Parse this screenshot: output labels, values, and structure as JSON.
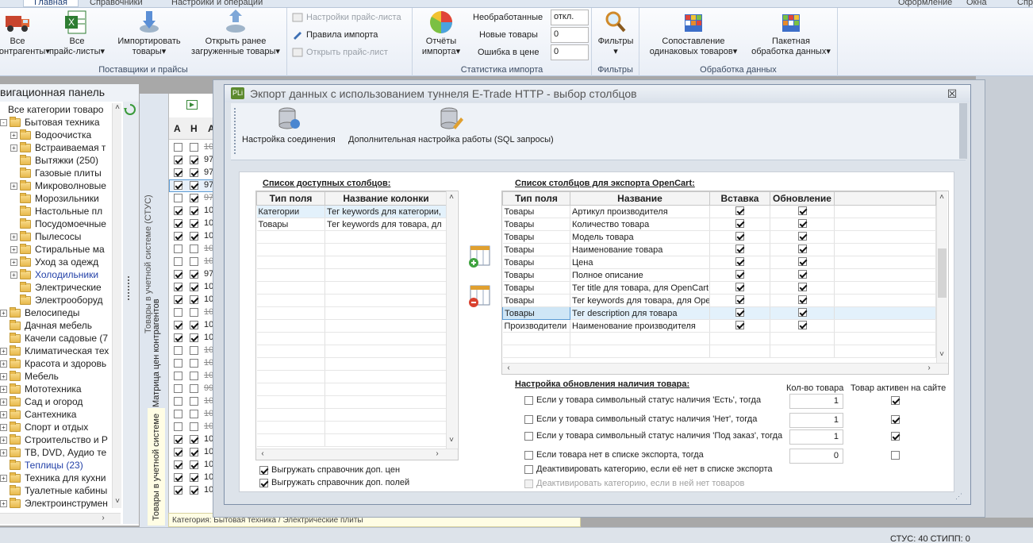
{
  "ribbon": {
    "tabs": [
      "Главная",
      "Справочники",
      "Настройки и операции"
    ],
    "right_links": [
      "Оформление",
      "Окна",
      "Спр"
    ],
    "groups": {
      "suppliers": {
        "label": "Поставщики и прайсы",
        "btn_all_contractors": "Все\nконтрагенты",
        "btn_all_pricelists": "Все\nпрайс-листы",
        "btn_import_goods": "Импортировать\nтовары",
        "btn_open_loaded": "Открыть ранее\nзагруженные товары",
        "cmd_price_settings": "Настройки прайс-листа",
        "cmd_import_rules": "Правила импорта",
        "cmd_open_price": "Открыть прайс-лист"
      },
      "stats": {
        "label": "Статистика импорта",
        "btn_reports": "Отчёты\nимпорта",
        "rows": [
          {
            "label": "Необработанные",
            "value": "откл."
          },
          {
            "label": "Новые товары",
            "value": "0"
          },
          {
            "label": "Ошибка в цене",
            "value": "0"
          }
        ]
      },
      "filters": {
        "label": "Фильтры",
        "btn_filters": "Фильтры"
      },
      "processing": {
        "label": "Обработка данных",
        "btn_match": "Сопоставление\nодинаковых товаров",
        "btn_batch": "Пакетная\nобработка данных"
      }
    }
  },
  "nav": {
    "title": "вигационная панель",
    "items": [
      {
        "label": "Все категории товаро",
        "level": 0,
        "exp": "",
        "blue": false,
        "folder": false
      },
      {
        "label": "Бытовая техника",
        "level": 0,
        "exp": "-",
        "blue": false,
        "folder": true
      },
      {
        "label": "Водоочистка",
        "level": 1,
        "exp": "+",
        "blue": false,
        "folder": true
      },
      {
        "label": "Встраиваемая т",
        "level": 1,
        "exp": "+",
        "blue": false,
        "folder": true
      },
      {
        "label": "Вытяжки (250)",
        "level": 1,
        "exp": "",
        "blue": false,
        "folder": true
      },
      {
        "label": "Газовые плиты",
        "level": 1,
        "exp": "",
        "blue": false,
        "folder": true
      },
      {
        "label": "Микроволновые",
        "level": 1,
        "exp": "+",
        "blue": false,
        "folder": true
      },
      {
        "label": "Морозильники",
        "level": 1,
        "exp": "",
        "blue": false,
        "folder": true
      },
      {
        "label": "Настольные пл",
        "level": 1,
        "exp": "",
        "blue": false,
        "folder": true
      },
      {
        "label": "Посудомоечные",
        "level": 1,
        "exp": "",
        "blue": false,
        "folder": true
      },
      {
        "label": "Пылесосы",
        "level": 1,
        "exp": "+",
        "blue": false,
        "folder": true
      },
      {
        "label": "Стиральные ма",
        "level": 1,
        "exp": "+",
        "blue": false,
        "folder": true
      },
      {
        "label": "Уход за одежд",
        "level": 1,
        "exp": "+",
        "blue": false,
        "folder": true
      },
      {
        "label": "Холодильники",
        "level": 1,
        "exp": "+",
        "blue": true,
        "folder": true
      },
      {
        "label": "Электрические",
        "level": 1,
        "exp": "",
        "blue": false,
        "folder": true
      },
      {
        "label": "Электрооборуд",
        "level": 1,
        "exp": "",
        "blue": false,
        "folder": true
      },
      {
        "label": "Велосипеды",
        "level": 0,
        "exp": "+",
        "blue": false,
        "folder": true
      },
      {
        "label": "Дачная мебель",
        "level": 0,
        "exp": "",
        "blue": false,
        "folder": true
      },
      {
        "label": "Качели садовые (7",
        "level": 0,
        "exp": "",
        "blue": false,
        "folder": true
      },
      {
        "label": "Климатическая тех",
        "level": 0,
        "exp": "+",
        "blue": false,
        "folder": true
      },
      {
        "label": "Красота и здоровь",
        "level": 0,
        "exp": "+",
        "blue": false,
        "folder": true
      },
      {
        "label": "Мебель",
        "level": 0,
        "exp": "+",
        "blue": false,
        "folder": true
      },
      {
        "label": "Мототехника",
        "level": 0,
        "exp": "+",
        "blue": false,
        "folder": true
      },
      {
        "label": "Сад и огород",
        "level": 0,
        "exp": "+",
        "blue": false,
        "folder": true
      },
      {
        "label": "Сантехника",
        "level": 0,
        "exp": "+",
        "blue": false,
        "folder": true
      },
      {
        "label": "Спорт и отдых",
        "level": 0,
        "exp": "+",
        "blue": false,
        "folder": true
      },
      {
        "label": "Строительство и Р",
        "level": 0,
        "exp": "+",
        "blue": false,
        "folder": true
      },
      {
        "label": "ТВ, DVD, Аудио те",
        "level": 0,
        "exp": "+",
        "blue": false,
        "folder": true
      },
      {
        "label": "Теплицы (23)",
        "level": 0,
        "exp": "",
        "blue": true,
        "folder": true
      },
      {
        "label": "Техника для кухни",
        "level": 0,
        "exp": "+",
        "blue": false,
        "folder": true
      },
      {
        "label": "Туалетные кабины",
        "level": 0,
        "exp": "",
        "blue": false,
        "folder": true
      },
      {
        "label": "Электроинструмен",
        "level": 0,
        "exp": "+",
        "blue": false,
        "folder": true
      }
    ]
  },
  "side_tabs": {
    "tab1": "Товары в учетной системе (СТУС)",
    "tab2": "Матрица цен контрагентов",
    "tab3": "Товары в учетной системе"
  },
  "grid": {
    "headers": [
      "А",
      "Н",
      "А"
    ],
    "rows": [
      {
        "a": false,
        "n": false,
        "v": "10"
      },
      {
        "a": true,
        "n": true,
        "v": "97"
      },
      {
        "a": true,
        "n": true,
        "v": "97"
      },
      {
        "a": true,
        "n": true,
        "v": "97"
      },
      {
        "a": false,
        "n": true,
        "v": "97"
      },
      {
        "a": true,
        "n": true,
        "v": "10"
      },
      {
        "a": true,
        "n": true,
        "v": "10"
      },
      {
        "a": true,
        "n": true,
        "v": "10"
      },
      {
        "a": false,
        "n": false,
        "v": "10"
      },
      {
        "a": false,
        "n": false,
        "v": "10"
      },
      {
        "a": true,
        "n": true,
        "v": "97"
      },
      {
        "a": true,
        "n": true,
        "v": "10"
      },
      {
        "a": true,
        "n": true,
        "v": "10"
      },
      {
        "a": false,
        "n": false,
        "v": "10"
      },
      {
        "a": true,
        "n": true,
        "v": "10"
      },
      {
        "a": true,
        "n": true,
        "v": "10"
      },
      {
        "a": false,
        "n": false,
        "v": "10"
      },
      {
        "a": false,
        "n": false,
        "v": "10"
      },
      {
        "a": false,
        "n": false,
        "v": "10"
      },
      {
        "a": false,
        "n": false,
        "v": "99"
      },
      {
        "a": false,
        "n": false,
        "v": "10"
      },
      {
        "a": false,
        "n": false,
        "v": "10"
      },
      {
        "a": false,
        "n": false,
        "v": "10"
      },
      {
        "a": true,
        "n": true,
        "v": "10"
      },
      {
        "a": true,
        "n": true,
        "v": "10"
      },
      {
        "a": true,
        "n": true,
        "v": "10"
      },
      {
        "a": true,
        "n": true,
        "v": "10"
      },
      {
        "a": true,
        "n": true,
        "v": "10"
      }
    ]
  },
  "status_strip": "Категория: Бытовая техника / Электрические плиты",
  "status_bar": "СТУС: 40  СТИПП: 0",
  "dialog": {
    "logo": "PLi",
    "title": "Экпорт данных с использованием туннеля E-Trade HTTP - выбор столбцов",
    "toolbar": {
      "connection": "Настройка соединения",
      "advanced": "Дополнительная настройка работы (SQL запросы)"
    },
    "available": {
      "title": "Список доступных столбцов:",
      "headers": [
        "Тип поля",
        "Название колонки"
      ],
      "rows": [
        [
          "Категории",
          "Тег keywords для категории,"
        ],
        [
          "Товары",
          "Тег keywords для товара, дл"
        ]
      ]
    },
    "export": {
      "title": "Список столбцов для экспорта OpenCart:",
      "headers": [
        "Тип поля",
        "Название",
        "Вставка",
        "Обновление"
      ],
      "rows": [
        {
          "type": "Товары",
          "name": "Артикул производителя",
          "ins": true,
          "upd": true
        },
        {
          "type": "Товары",
          "name": "Количество товара",
          "ins": true,
          "upd": true
        },
        {
          "type": "Товары",
          "name": "Модель товара",
          "ins": true,
          "upd": true
        },
        {
          "type": "Товары",
          "name": "Наименование товара",
          "ins": true,
          "upd": true
        },
        {
          "type": "Товары",
          "name": "Цена",
          "ins": true,
          "upd": true
        },
        {
          "type": "Товары",
          "name": "Полное описание",
          "ins": true,
          "upd": true
        },
        {
          "type": "Товары",
          "name": "Тег title для товара, для OpenCart",
          "ins": true,
          "upd": true
        },
        {
          "type": "Товары",
          "name": "Тег keywords для товара, для Ope",
          "ins": true,
          "upd": true
        },
        {
          "type": "Товары",
          "name": "Тег description для товара",
          "ins": true,
          "upd": true
        },
        {
          "type": "Производители",
          "name": "Наименование производителя",
          "ins": true,
          "upd": true
        }
      ]
    },
    "checkboxes": {
      "price_ref": "Выгружать справочник доп. цен",
      "fields_ref": "Выгружать справочник доп. полей"
    },
    "availability": {
      "title": "Настройка обновления наличия товара:",
      "col_qty": "Кол-во товара",
      "col_active": "Товар активен на сайте",
      "rows": [
        {
          "label": "Если у товара символьный статус наличия 'Есть', тогда",
          "qty": "1",
          "active": true
        },
        {
          "label": "Если у товара символьный статус наличия 'Нет', тогда",
          "qty": "1",
          "active": true
        },
        {
          "label": "Если у товара символьный статус наличия 'Под заказ', тогда",
          "qty": "1",
          "active": true
        },
        {
          "label": "Если товара нет в списке экспорта, тогда",
          "qty": "0",
          "active": false
        }
      ],
      "deactivate1": "Деактивировать категорию, если её нет в списке экспорта",
      "deactivate2": "Деактивировать категорию, если в ней нет товаров"
    }
  }
}
